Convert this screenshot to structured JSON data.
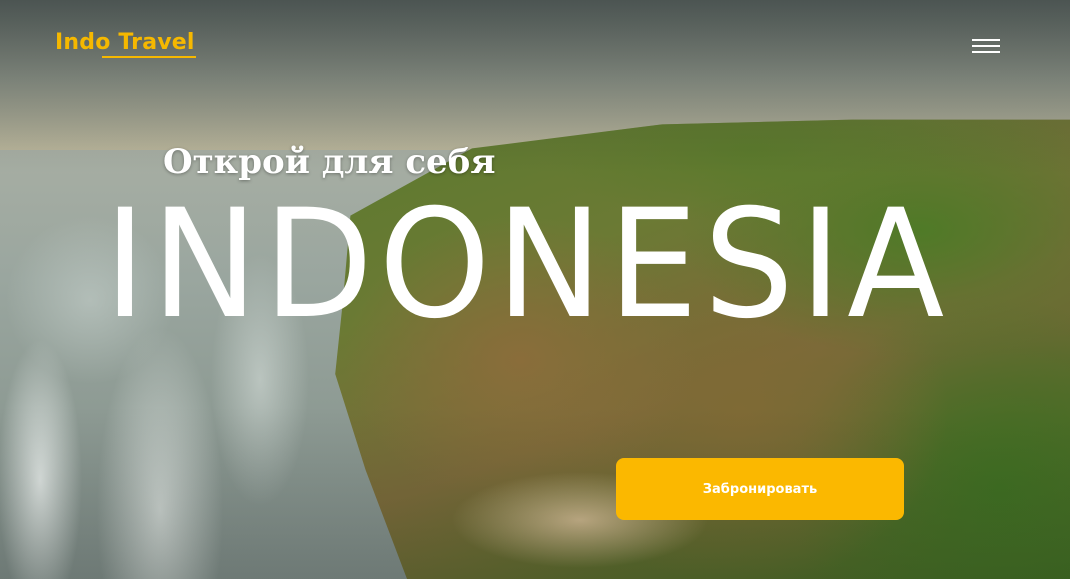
{
  "header": {
    "logo": "Indo Travel",
    "menu_icon": "hamburger-menu-icon"
  },
  "hero": {
    "subtitle": "Открой для себя",
    "headline": "INDONESIA",
    "cta_label": "Забронировать"
  },
  "colors": {
    "accent": "#fbb800",
    "text": "#ffffff"
  }
}
